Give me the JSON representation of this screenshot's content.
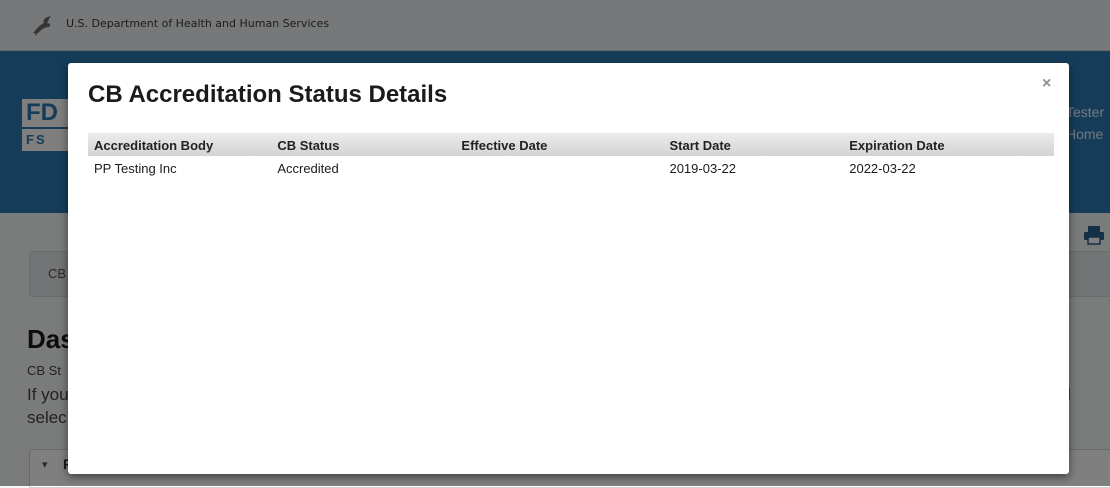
{
  "banner": {
    "text": "U.S. Department of Health and Human Services"
  },
  "header": {
    "logo_top": "FD",
    "logo_bottom": "FS",
    "user_name": "Tester",
    "home_link": "Home"
  },
  "breadcrumb": {
    "text": "CB"
  },
  "page": {
    "heading": "Das",
    "status_line": "CB St",
    "info_line1": "If you",
    "info_line2": "selec",
    "info_right": "l"
  },
  "accordion": {
    "caret": "▾",
    "label": "F"
  },
  "modal": {
    "title": "CB Accreditation Status Details",
    "close": "×",
    "columns": [
      "Accreditation Body",
      "CB Status",
      "Effective Date",
      "Start Date",
      "Expiration Date"
    ],
    "rows": [
      [
        "PP Testing Inc",
        "Accredited",
        "",
        "2019-03-22",
        "2022-03-22"
      ]
    ]
  },
  "colors": {
    "header_blue": "#2a7ab3",
    "overlay": "rgba(0,0,0,0.5)",
    "modal_bg": "#ffffff",
    "table_header": "#d3d3d3"
  },
  "icons": [
    "hhs-eagle-icon",
    "print-icon",
    "close-icon",
    "caret-down-icon"
  ]
}
